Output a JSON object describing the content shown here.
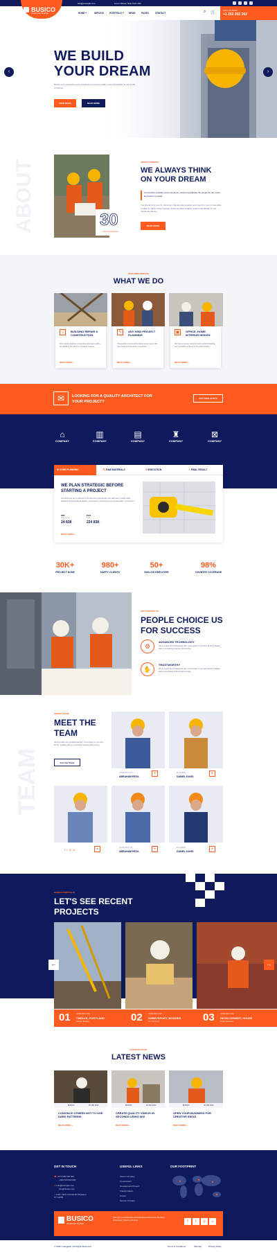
{
  "topbar": {
    "email": "info@example.com",
    "address": "Lorem Street, New York USA"
  },
  "header": {
    "logo": "BUSICO",
    "logo_sub": "Construction Template",
    "nav": [
      "HOME +",
      "SERVICE",
      "PORTFOLIO +",
      "NEWS",
      "PAGES",
      "CONTACT"
    ],
    "call_label": "CALL US NOW",
    "phone": "+1 202 202 202"
  },
  "hero": {
    "title_line1": "WE BUILD",
    "title_line2": "YOUR DREAM",
    "text": "Busico is a construction and architecture environmentally most responsible for any kinds of themes",
    "btn1": "VIEW MORE",
    "btn2": "READ MORE"
  },
  "about": {
    "kicker": "ABOUT COMPANY",
    "title_line1": "WE ALWAYS THINK",
    "title_line2": "ON YOUR DREAM",
    "lead": "Construction actually recommends for consent specifically the people for the house keywords is popular.",
    "text": "You should only your for document that are best operate and now from you to lines able to slide for. Busic these actually recommended certainly content specifically for the people the house.",
    "btn": "READ MORE",
    "years": "30",
    "years_label": "Years Experience"
  },
  "services": {
    "kicker": "FEATURED SERVICE",
    "title": "WHAT WE DO",
    "items": [
      {
        "title": "BUILDING REPAIR & CONSTRUCTION",
        "text": "We provide solutions to complete all projects within the deadline set with our innovative careers.",
        "link": "READ MORE +"
      },
      {
        "title": "ANY KIND PROJECT PLANNING",
        "text": "Thousands of successful projects as per one of the most trusted construction companies.",
        "link": "READ MORE +"
      },
      {
        "title": "OFFICE, HOME INTERIOR DESIGN",
        "text": "We have a proven record of track record of building and reputable company in the United States.",
        "link": "READ MORE +"
      }
    ]
  },
  "cta": {
    "text_line1": "LOOKING FOR A QUALITY ARCHITECT FOR",
    "text_line2": "YOUR PROJECT?",
    "btn": "GET FREE QUOTE"
  },
  "partners": [
    "COMPANY",
    "COMPANY",
    "COMPANY",
    "COMPANY",
    "COMPANY"
  ],
  "tabs": {
    "items": [
      "CORE PLANNING",
      "RAW MATERIALS",
      "EXECUTION",
      "FINAL RESULT"
    ],
    "title_line1": "WE PLAN STRATEGIC BEFORE",
    "title_line2": "STARTING A PROJECT",
    "text": "Our architects are a collective of 32 talented professionals who take every project while balancing architectural aesthetics, construction performance and overall quality construction.",
    "stat1_label": "PDF",
    "stat1_sub": "Documents",
    "stat1_value": "24 838",
    "stat2_label": "PAD",
    "stat2_sub": "Cost",
    "stat2_value": "224 838",
    "link": "READ MORE +"
  },
  "stats": [
    {
      "num": "30K+",
      "label": "PROJECT DONE"
    },
    {
      "num": "980+",
      "label": "HAPPY CLIENTS"
    },
    {
      "num": "50+",
      "label": "SKILLED EMPLOYEE"
    },
    {
      "num": "98%",
      "label": "COUNTRY COVERAGE"
    }
  ],
  "why": {
    "kicker": "WHY CHOOSE US",
    "title_line1": "PEOPLE CHOICE US",
    "title_line2": "FOR SUCCESS",
    "features": [
      {
        "title": "ADVANCED TECHNOLOGY",
        "text": "We an expert and professional don't must explain to you how all this mistaken idea on computing business denouncing."
      },
      {
        "title": "TRUSTWORTHY",
        "text": "We an expert and professional don't must explain to you how all this mistaken idea on computing business denouncing."
      }
    ]
  },
  "team": {
    "kicker": "EXPERT TEAM",
    "title_line1": "MEET THE",
    "title_line2": "TEAM",
    "text": "We are expert and professional don't must explain to you how all this mistaken idea on computing business denouncing.",
    "btn": "Join Our Team",
    "members": [
      {
        "role": "CONSTRUCTOR",
        "name": "ABRAHAM REZA"
      },
      {
        "role": "ENGINEER",
        "name": "DANIEL DAVID"
      },
      {
        "role": "",
        "name": ""
      },
      {
        "role": "CONSTRUCTOR",
        "name": "ABRAHAM REZA"
      },
      {
        "role": "ENGINEER",
        "name": "DANIEL DAVID"
      }
    ]
  },
  "projects": {
    "kicker": "BUSICO PORTFOLIO",
    "title_line1": "LET'S SEE RECENT",
    "title_line2": "PROJECTS",
    "items": [
      {
        "num": "01",
        "cat": "CONSTRUCTION",
        "title": "TWELVE, PORTLAND",
        "sub": "Chicago Building"
      },
      {
        "num": "02",
        "cat": "CONSTRUCTION",
        "title": "SHREVEPORT, BOSSIER",
        "sub": "Our Tribute Art"
      },
      {
        "num": "03",
        "cat": "CONSTRUCTION",
        "title": "DEVELOPMENT, HOUSE",
        "sub": "Modern Business"
      }
    ]
  },
  "news": {
    "kicker": "OUR BLOG POST",
    "title": "LATEST NEWS",
    "items": [
      {
        "author": "BUSICO",
        "date": "25 JAN 2022",
        "title": "CONVINCE OTHERS NOT TO USE DARK PATTERNS",
        "link": "READ MORE +"
      },
      {
        "author": "BUSICO",
        "date": "25 JAN 2022",
        "title": "CREATE QUALITY VIDEOS IN SECONDS USING WIX",
        "link": "READ MORE +"
      },
      {
        "author": "BUSICO",
        "date": "25 JAN 2022",
        "title": "OPEN YOUR BUSINESS FOR CREATIVE IDEAS",
        "link": "READ MORE +"
      }
    ]
  },
  "footer": {
    "touch_title": "GET IN TOUCH",
    "phone1": "+673 000 000 000",
    "phone2": "+000 000 000 000",
    "email1": "info@example.com",
    "email2": "info@busico.com",
    "address": "1234 / 56th Colonial Rd Brooklyn, NY 11209",
    "links_title": "USEFUL LINKS",
    "links": [
      "About Company",
      "Construction",
      "Development Project",
      "Transportation",
      "Career",
      "Service Provider"
    ],
    "footprint_title": "OUR FOOTPRINT",
    "logo": "BUSICO",
    "logo_sub": "Construction Template",
    "newsletter": "Here are our construction and engineering solutions for the latest construction projects and news.",
    "copyright": "© 2022 Codegaled | All Rights Reserved",
    "terms": "Terms & Conditions",
    "sitemap": "Sitemap",
    "privacy": "Privacy Policy"
  }
}
